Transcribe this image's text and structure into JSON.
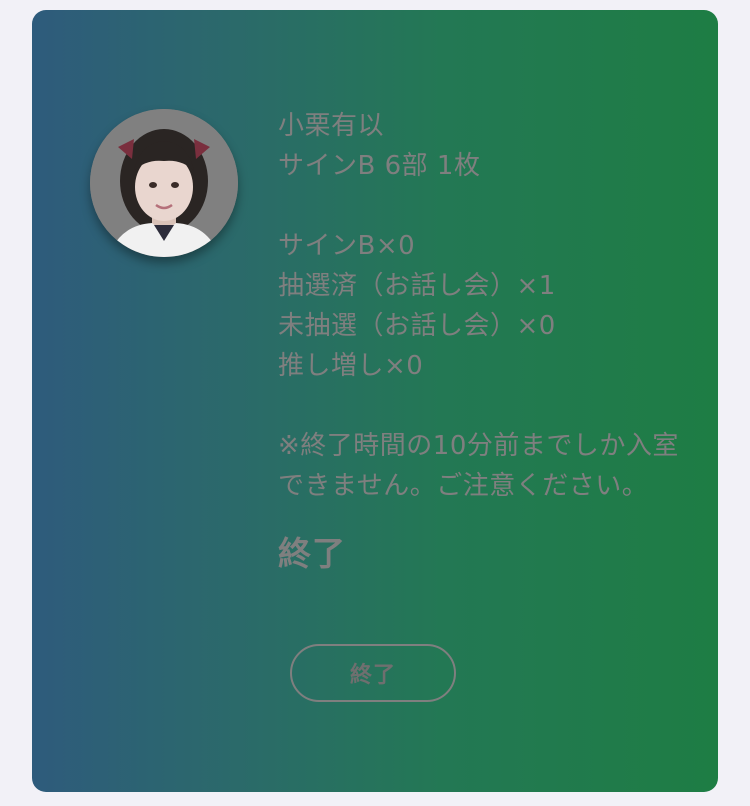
{
  "member": {
    "name": "小栗有以",
    "ticket": "サインB 6部 1枚"
  },
  "counts": [
    "サインB×0",
    "抽選済（お話し会）×1",
    "未抽選（お話し会）×0",
    "推し増し×0"
  ],
  "note": "※終了時間の10分前までしか入室できません。ご注意ください。",
  "status": "終了",
  "button": {
    "label": "終了"
  },
  "colors": {
    "background": "#f2f1f7",
    "gradient_start": "#2e5b7c",
    "gradient_end": "#1e7d44",
    "text": "#7f7f7f"
  }
}
